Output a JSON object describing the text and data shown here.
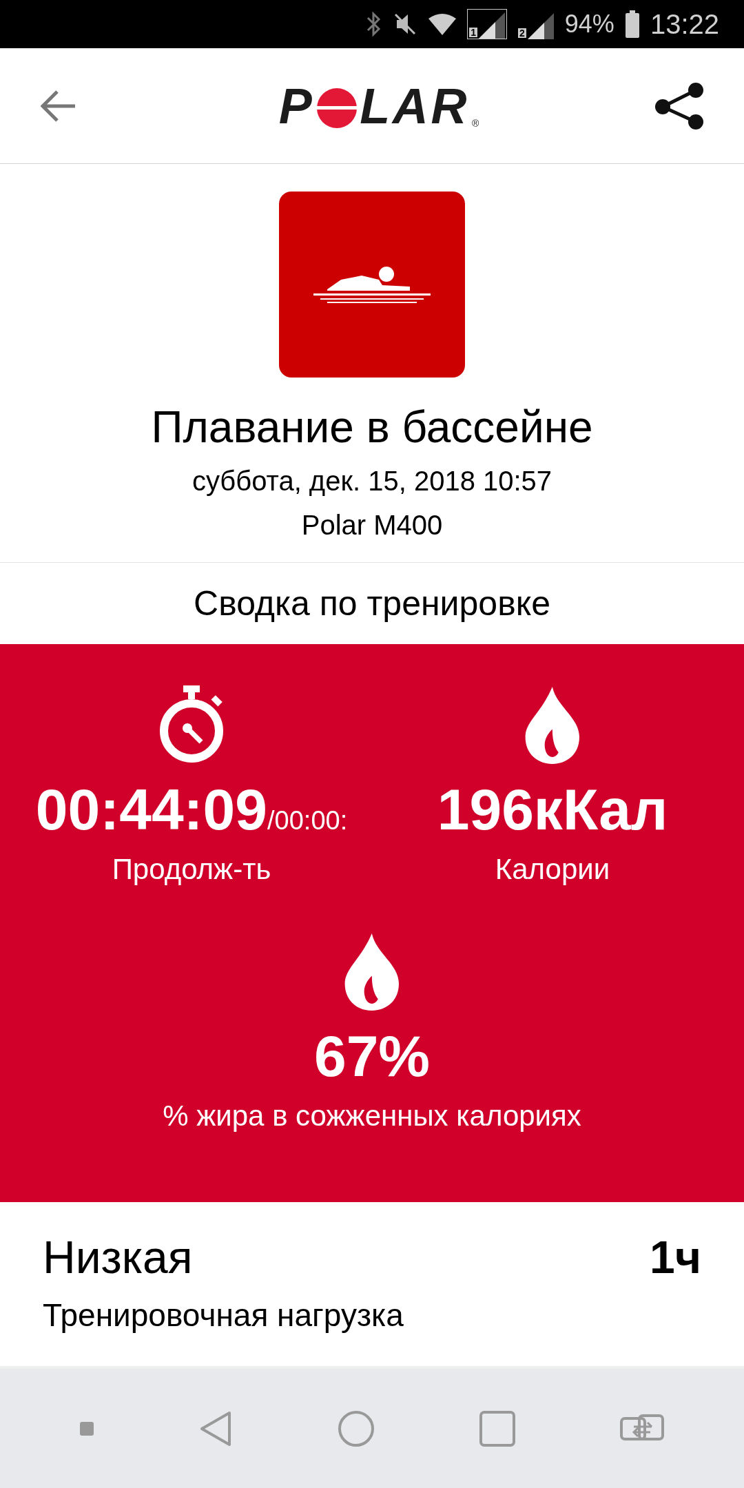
{
  "status_bar": {
    "battery": "94%",
    "time": "13:22",
    "sim_labels": [
      "1",
      "2"
    ]
  },
  "header": {
    "logo_before": "P",
    "logo_after": "LAR",
    "logo_mark": "®"
  },
  "activity": {
    "title": "Плавание в бассейне",
    "date": "суббота, дек. 15, 2018 10:57",
    "device": "Polar M400"
  },
  "summary_title": "Сводка по тренировке",
  "stats": [
    {
      "kind": "duration",
      "value": "00:44:09",
      "extra": "/00:00:",
      "label": "Продолж-ть"
    },
    {
      "kind": "calories",
      "value": "196кКал",
      "label": "Калории"
    },
    {
      "kind": "fat",
      "value": "67%",
      "label": "% жира в сожженных калориях"
    }
  ],
  "training_load": {
    "level": "Низкая",
    "duration": "1ч",
    "label": "Тренировочная нагрузка"
  }
}
